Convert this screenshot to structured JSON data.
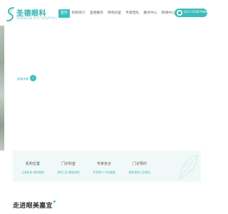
{
  "brand": {
    "name_cn": "圣德眼科",
    "name_en": "SHENGDE EYE HOSPITAL",
    "accent_color": "#3fbfbb",
    "logo_icon": "s-curve-logo-icon"
  },
  "nav": {
    "items": [
      {
        "label": "首页",
        "active": true
      },
      {
        "label": "机构简介",
        "active": false
      },
      {
        "label": "圣德服务",
        "active": false
      },
      {
        "label": "特色科室",
        "active": false
      },
      {
        "label": "专家团队",
        "active": false
      },
      {
        "label": "服务中心",
        "active": false
      },
      {
        "label": "新闻中心",
        "active": false
      },
      {
        "label": "联系我们",
        "active": false
      }
    ]
  },
  "phone": {
    "label": "021-55087988",
    "icon": "phone-icon"
  },
  "hero": {
    "label": "查看详情",
    "arrow_icon": "chevron-right-icon"
  },
  "cards": [
    {
      "title": "机构位置",
      "sub": "正新机构 来院路线"
    },
    {
      "title": "门诊科室",
      "sub": "特色门诊 眼部体检"
    },
    {
      "title": "专家坐诊",
      "sub": "专家简介 守护健康"
    },
    {
      "title": "门诊预约",
      "sub": "眼科预约门诊就诊"
    }
  ],
  "section": {
    "title": "走进眼美嘉宜"
  }
}
